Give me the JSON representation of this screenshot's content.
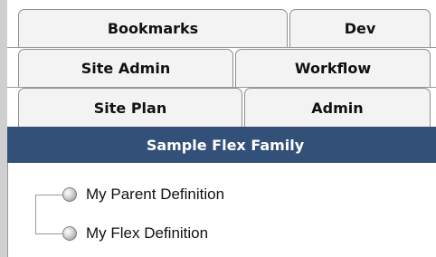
{
  "tabs": {
    "row1": [
      "Bookmarks",
      "Dev"
    ],
    "row2": [
      "Site Admin",
      "Workflow"
    ],
    "row3": [
      "Site Plan",
      "Admin"
    ]
  },
  "active_tab": "Sample Flex Family",
  "tree": {
    "items": [
      "My Parent Definition",
      "My Flex Definition"
    ]
  }
}
